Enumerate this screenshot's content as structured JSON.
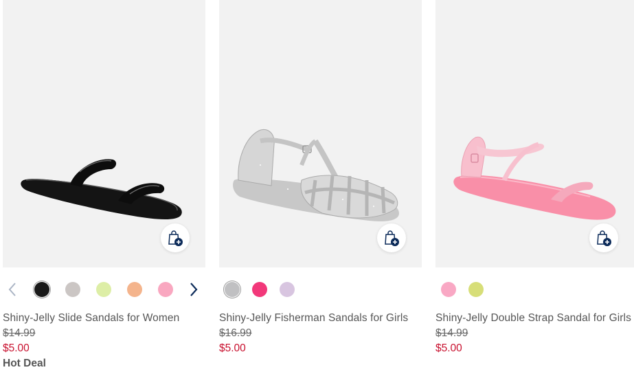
{
  "products": [
    {
      "title": "Shiny-Jelly Slide Sandals for Women",
      "original_price": "$14.99",
      "sale_price": "$5.00",
      "promo": "Hot Deal",
      "swatch_colors": [
        "#1a1a1a",
        "#cbc6c4",
        "#ddeea6",
        "#f4b48c",
        "#f9a7c0"
      ],
      "selected_swatch": 0
    },
    {
      "title": "Shiny-Jelly Fisherman Sandals for Girls",
      "original_price": "$16.99",
      "sale_price": "$5.00",
      "swatch_colors": [
        "#c0c0c2",
        "#f2387a",
        "#d8c5e0"
      ],
      "selected_swatch": 0
    },
    {
      "title": "Shiny-Jelly Double Strap Sandal for Girls",
      "original_price": "$14.99",
      "sale_price": "$5.00",
      "swatch_colors": [
        "#f9a8c4",
        "#d7de78"
      ]
    }
  ],
  "icons": {
    "add_to_bag": "shopping-bag-plus-icon",
    "prev": "chevron-left-icon",
    "next": "chevron-right-icon"
  },
  "colors": {
    "sale_red": "#c8102e",
    "nav_blue": "#0b2a59",
    "image_bg": "#f2f2f2"
  }
}
